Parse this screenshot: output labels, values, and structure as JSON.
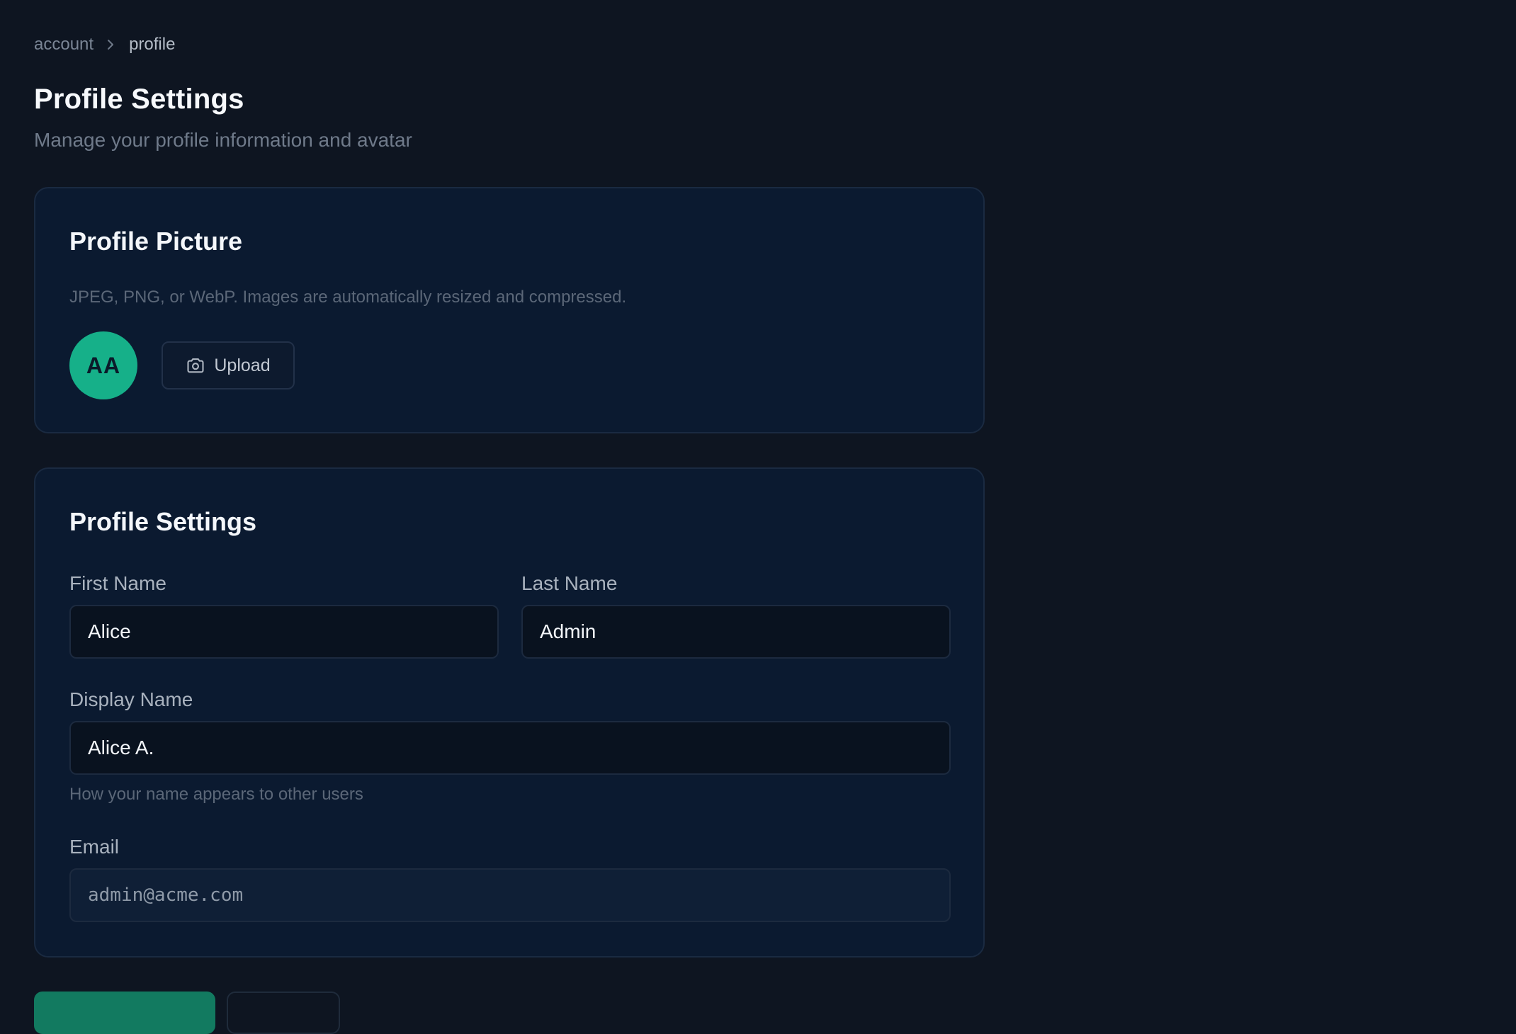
{
  "breadcrumb": {
    "parent": "account",
    "current": "profile",
    "separator_icon": "chevron-right-icon"
  },
  "header": {
    "title": "Profile Settings",
    "subtitle": "Manage your profile information and avatar"
  },
  "profile_picture": {
    "title": "Profile Picture",
    "hint": "JPEG, PNG, or WebP. Images are automatically resized and compressed.",
    "avatar_initials": "AA",
    "avatar_color": "#16b089",
    "upload_label": "Upload",
    "upload_icon": "camera-icon"
  },
  "profile_settings": {
    "title": "Profile Settings",
    "first_name": {
      "label": "First Name",
      "value": "Alice"
    },
    "last_name": {
      "label": "Last Name",
      "value": "Admin"
    },
    "display_name": {
      "label": "Display Name",
      "value": "Alice A.",
      "help": "How your name appears to other users"
    },
    "email": {
      "label": "Email",
      "value": "admin@acme.com",
      "readonly": true
    }
  },
  "colors": {
    "background": "#0e1521",
    "card": "#0b1a30",
    "accent": "#127a60"
  }
}
